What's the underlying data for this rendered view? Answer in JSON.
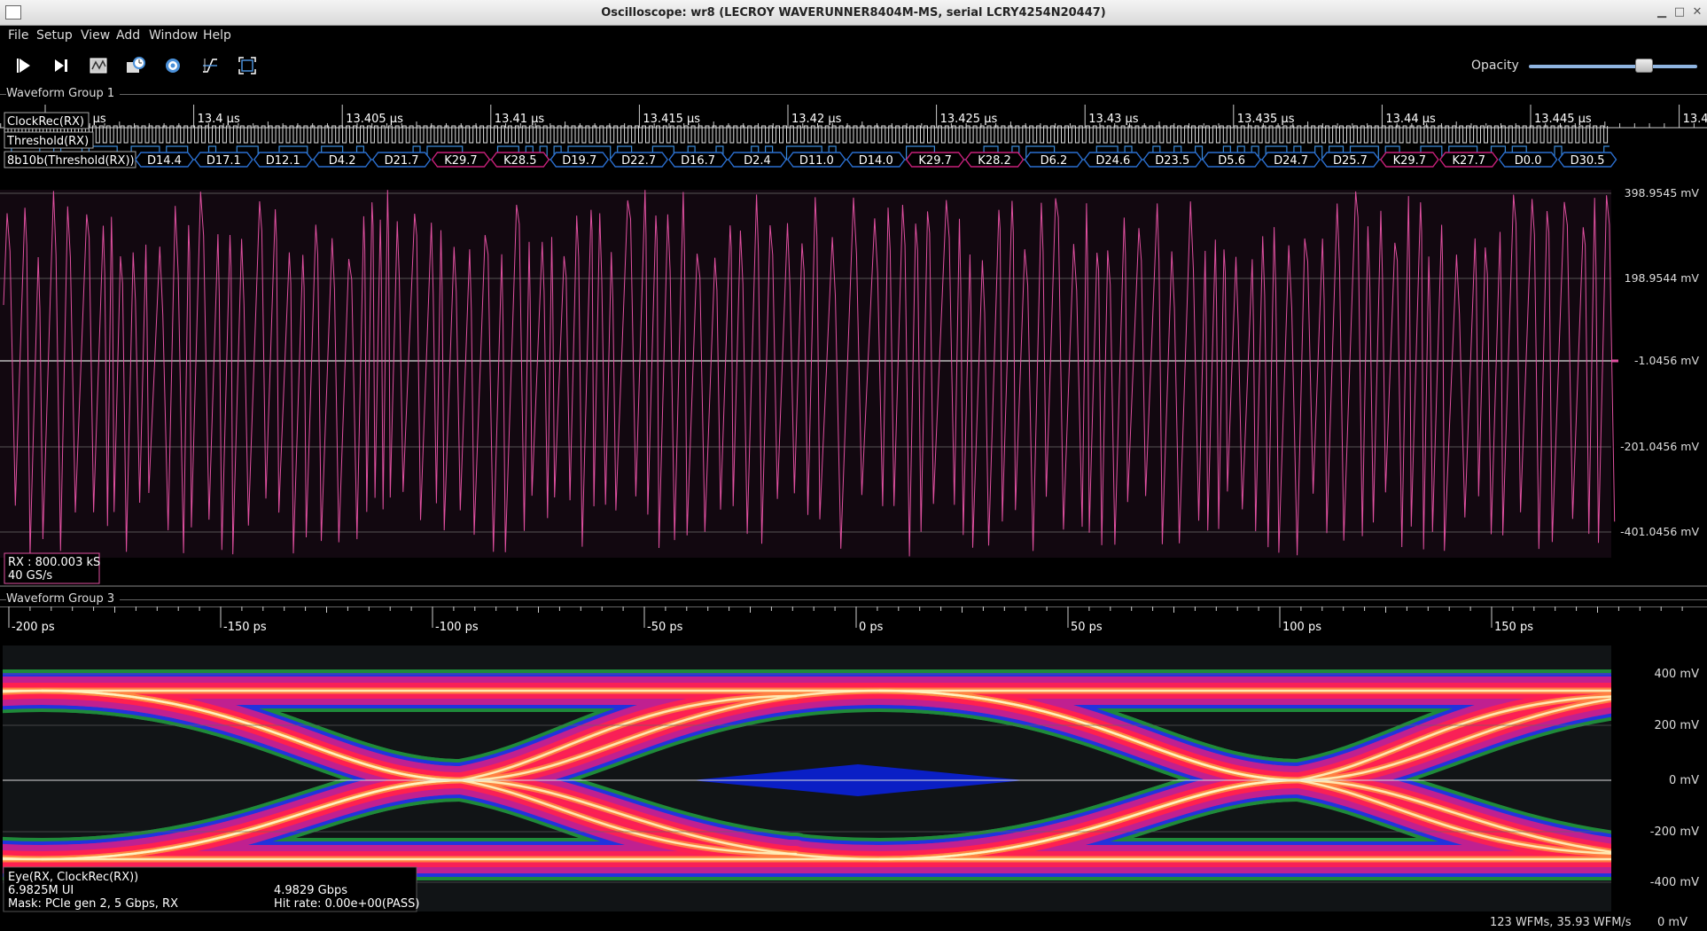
{
  "window": {
    "title": "Oscilloscope: wr8 (LECROY WAVERUNNER8404M-MS, serial LCRY4254N20447)"
  },
  "menu": [
    "File",
    "Setup",
    "View",
    "Add",
    "Window",
    "Help"
  ],
  "toolbar": {
    "buttons": [
      "start-icon",
      "single-trigger-icon",
      "waveform-icon",
      "history-icon",
      "settings-icon",
      "trigger-edge-icon",
      "fullscreen-icon"
    ],
    "opacity_label": "Opacity",
    "opacity_value": 0.75
  },
  "group1": {
    "title": "Waveform Group 1",
    "time_ticks": [
      "13.395 µs",
      "13.4 µs",
      "13.405 µs",
      "13.41 µs",
      "13.415 µs",
      "13.42 µs",
      "13.425 µs",
      "13.43 µs",
      "13.435 µs",
      "13.44 µs",
      "13.445 µs",
      "13.4"
    ],
    "channels": [
      {
        "label": "ClockRec(RX)"
      },
      {
        "label": "Threshold(RX)"
      },
      {
        "label": "8b10b(Threshold(RX))"
      }
    ],
    "symbols": [
      "D14.4",
      "D17.1",
      "D12.1",
      "D4.2",
      "D21.7",
      "K29.7",
      "K28.5",
      "D19.7",
      "D22.7",
      "D16.7",
      "D2.4",
      "D11.0",
      "D14.0",
      "K29.7",
      "K28.2",
      "D6.2",
      "D24.6",
      "D23.5",
      "D5.6",
      "D24.7",
      "D25.7",
      "K29.7",
      "K27.7",
      "D0.0",
      "D30.5"
    ],
    "y_ticks": [
      "398.9545 mV",
      "198.9544 mV",
      "-1.0456 mV",
      "-201.0456 mV",
      "-401.0456 mV"
    ],
    "info_line1": "RX : 800.003 kS",
    "info_line2": "40 GS/s"
  },
  "group3": {
    "title": "Waveform Group 3",
    "time_ticks": [
      "-200 ps",
      "-150 ps",
      "-100 ps",
      "-50 ps",
      "0 ps",
      "50 ps",
      "100 ps",
      "150 ps"
    ],
    "y_ticks": [
      "400 mV",
      "200 mV",
      "0 mV",
      "-200 mV",
      "-400 mV"
    ],
    "info_title": "Eye(RX, ClockRec(RX))",
    "info_ui": "6.9825M UI",
    "info_rate": "4.9829 Gbps",
    "info_mask": "Mask: PCIe gen 2, 5 Gbps, RX",
    "info_hit": "Hit rate: 0.00e+00(PASS)"
  },
  "status": {
    "wfms": "123 WFMs, 35.93 WFM/s",
    "value": "0 mV"
  },
  "colors": {
    "analog": "#e050a0",
    "digital": "#3b8ad8",
    "kchar": "#c8207a",
    "dchar": "#2b6fd0"
  }
}
